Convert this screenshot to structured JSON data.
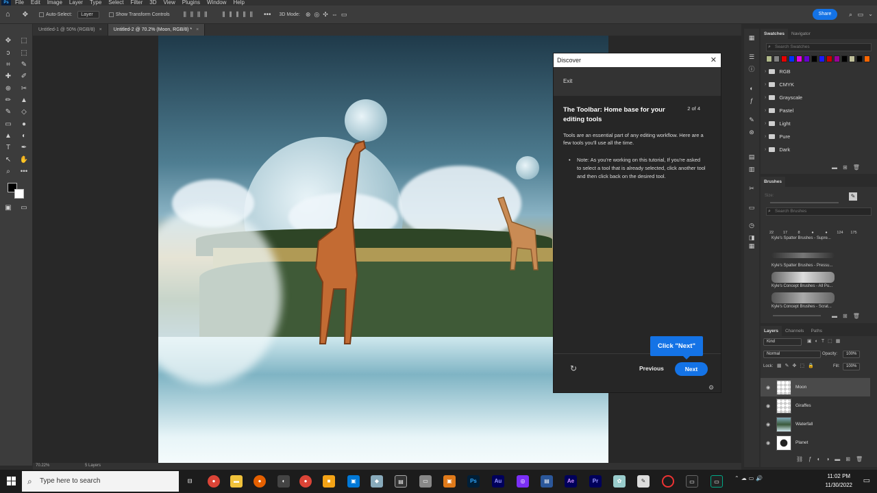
{
  "menu": [
    "File",
    "Edit",
    "Image",
    "Layer",
    "Type",
    "Select",
    "Filter",
    "3D",
    "View",
    "Plugins",
    "Window",
    "Help"
  ],
  "options": {
    "auto_select_label": "Auto-Select:",
    "layer_value": "Layer",
    "show_transform": "Show Transform Controls",
    "mode_3d": "3D Mode:",
    "share_label": "Share"
  },
  "tabs": [
    {
      "label": "Untitled-1 @ 50% (RGB/8)",
      "active": false
    },
    {
      "label": "Untitled-2 @ 70.2% (Moon, RGB/8) *",
      "active": true
    }
  ],
  "discover": {
    "title": "Discover",
    "exit_label": "Exit",
    "heading": "The Toolbar: Home base for your editing tools",
    "step": "2 of 4",
    "paragraph": "Tools are an essential part of any editing workflow. Here are a few tools you'll use all the time.",
    "note": "Note: As you're working on this tutorial, If you're asked to select a tool that is already selected, click another tool and then click back on the desired tool.",
    "previous_label": "Previous",
    "next_label": "Next",
    "callout": "Click \"Next\""
  },
  "swatches": {
    "tabs": [
      "Swatches",
      "Navigator"
    ],
    "search_placeholder": "Search Swatches",
    "colors": [
      "#b0b98a",
      "#808080",
      "#e60000",
      "#0033ff",
      "#e600e6",
      "#6600cc",
      "#000000",
      "#1a1aff",
      "#cc0000",
      "#990099",
      "#000000",
      "#bfbf99",
      "#000000",
      "#ff6600"
    ],
    "folders": [
      "RGB",
      "CMYK",
      "Grayscale",
      "Pastel",
      "Light",
      "Pure",
      "Dark"
    ]
  },
  "brushes": {
    "tab": "Brushes",
    "size_label": "Size:",
    "search_placeholder": "Search Brushes",
    "tip_sizes": [
      "22",
      "17",
      "8",
      "",
      "",
      "124",
      "175"
    ],
    "items": [
      "Kyle's Spatter Brushes - Supre...",
      "Kyle's Spatter Brushes - Pressu...",
      "Kyle's Concept Brushes - All Pu...",
      "Kyle's Concept Brushes - Scrat..."
    ]
  },
  "layers": {
    "tabs": [
      "Layers",
      "Channels",
      "Paths"
    ],
    "kind": "Kind",
    "blend": "Normal",
    "opacity_label": "Opacity:",
    "opacity_value": "100%",
    "lock_label": "Lock:",
    "fill_label": "Fill:",
    "fill_value": "100%",
    "items": [
      {
        "name": "Moon",
        "selected": true
      },
      {
        "name": "Giraffes",
        "selected": false
      },
      {
        "name": "Waterfall",
        "selected": false
      },
      {
        "name": "Planet",
        "selected": false
      }
    ]
  },
  "status": {
    "zoom": "70.22%",
    "layers": "5 Layers"
  },
  "taskbar": {
    "search_placeholder": "Type here to search",
    "time": "11:02 PM",
    "date": "11/30/2022"
  },
  "icons": {
    "move": "move-icon",
    "marquee": "marquee-icon",
    "lasso": "lasso-icon",
    "crop": "crop-icon"
  }
}
